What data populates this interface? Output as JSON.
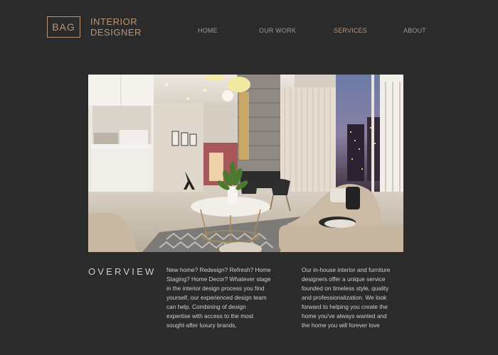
{
  "header": {
    "logo_text": "BAG",
    "brand_line1": "INTERIOR",
    "brand_line2": "DESIGNER"
  },
  "nav": {
    "items": [
      {
        "label": "HOME"
      },
      {
        "label": "OUR WORK"
      },
      {
        "label": "SERVICES"
      },
      {
        "label": "ABOUT"
      }
    ],
    "active": "SERVICES"
  },
  "overview": {
    "title": "OVERVIEW",
    "paragraph1": [
      "New home? Redesign? Refresh? Home",
      "Staging? Home Decor? Whatever stage",
      "in the interior design process you find",
      "yourself, our experienced design team",
      "can help. Combining of design",
      "expertise with access to the most",
      "sought-after luxury brands,"
    ],
    "paragraph2": [
      "Our in-house interior and furniture",
      "designers offer a unique service",
      "founded on timeless style, quality",
      "and professionalization. We look",
      "forward to helping you create the",
      "home you've always wanted and",
      "the home you will forever love"
    ]
  },
  "colors": {
    "background": "#2b2b2b",
    "accent": "#b9967a",
    "nav_inactive": "#9a9a9a",
    "text": "#d0d0d0"
  }
}
